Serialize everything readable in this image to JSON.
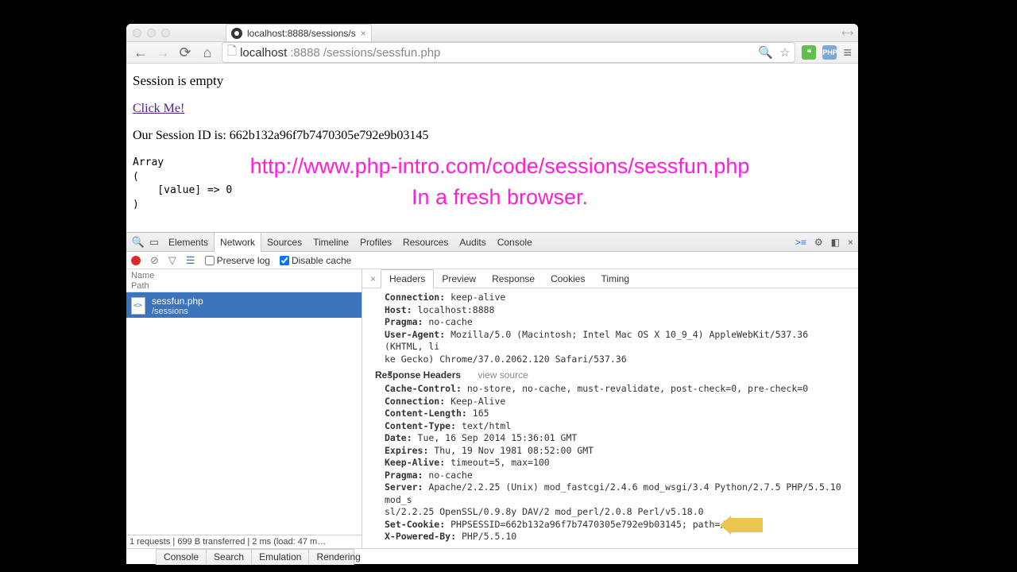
{
  "window": {
    "tab_title": "localhost:8888/sessions/s",
    "tab_close": "×",
    "expand": "⤢"
  },
  "toolbar": {
    "back": "←",
    "forward": "→",
    "reload": "⟳",
    "home": "⌂",
    "page_icon": "🗋",
    "url_host": "localhost",
    "url_port": ":8888",
    "url_path": "/sessions/sessfun.php",
    "zoom_icon": "🔍",
    "star_icon": "☆",
    "ext1": "❝",
    "ext2": "PHP",
    "menu": "≡"
  },
  "page": {
    "h1": "Session is empty",
    "link": "Click Me!",
    "session_line": "Our Session ID is: 662b132a96f7b7470305e792e9b03145",
    "pre": "Array\n(\n    [value] => 0\n)",
    "annot1": "http://www.php-intro.com/code/sessions/sessfun.php",
    "annot2": "In a fresh browser."
  },
  "devtools": {
    "tabs": [
      "Elements",
      "Network",
      "Sources",
      "Timeline",
      "Profiles",
      "Resources",
      "Audits",
      "Console"
    ],
    "active_tab": 1,
    "preserve": "Preserve log",
    "disable_cache": "Disable cache",
    "left": {
      "name": "Name",
      "path": "Path",
      "file": "sessfun.php",
      "folder": "/sessions",
      "status": "1 requests | 699 B transferred | 2 ms (load: 47 m…"
    },
    "detail_tabs": [
      "Headers",
      "Preview",
      "Response",
      "Cookies",
      "Timing"
    ],
    "req_headers": [
      {
        "k": "Connection:",
        "v": " keep-alive"
      },
      {
        "k": "Host:",
        "v": " localhost:8888"
      },
      {
        "k": "Pragma:",
        "v": " no-cache"
      },
      {
        "k": "User-Agent:",
        "v": " Mozilla/5.0 (Macintosh; Intel Mac OS X 10_9_4) AppleWebKit/537.36 (KHTML, li"
      },
      {
        "k": "",
        "v": "ke Gecko) Chrome/37.0.2062.120 Safari/537.36"
      }
    ],
    "resp_section": "Response Headers",
    "view_source": "view source",
    "resp_headers": [
      {
        "k": "Cache-Control:",
        "v": " no-store, no-cache, must-revalidate, post-check=0, pre-check=0"
      },
      {
        "k": "Connection:",
        "v": " Keep-Alive"
      },
      {
        "k": "Content-Length:",
        "v": " 165"
      },
      {
        "k": "Content-Type:",
        "v": " text/html"
      },
      {
        "k": "Date:",
        "v": " Tue, 16 Sep 2014 15:36:01 GMT"
      },
      {
        "k": "Expires:",
        "v": " Thu, 19 Nov 1981 08:52:00 GMT"
      },
      {
        "k": "Keep-Alive:",
        "v": " timeout=5, max=100"
      },
      {
        "k": "Pragma:",
        "v": " no-cache"
      },
      {
        "k": "Server:",
        "v": " Apache/2.2.25 (Unix) mod_fastcgi/2.4.6 mod_wsgi/3.4 Python/2.7.5 PHP/5.5.10 mod_s"
      },
      {
        "k": "",
        "v": "sl/2.2.25 OpenSSL/0.9.8y DAV/2 mod_perl/2.0.8 Perl/v5.18.0"
      },
      {
        "k": "Set-Cookie:",
        "v": " PHPSESSID=662b132a96f7b7470305e792e9b03145; path=/"
      },
      {
        "k": "X-Powered-By:",
        "v": " PHP/5.5.10"
      }
    ],
    "drawer": [
      "Console",
      "Search",
      "Emulation",
      "Rendering"
    ]
  }
}
